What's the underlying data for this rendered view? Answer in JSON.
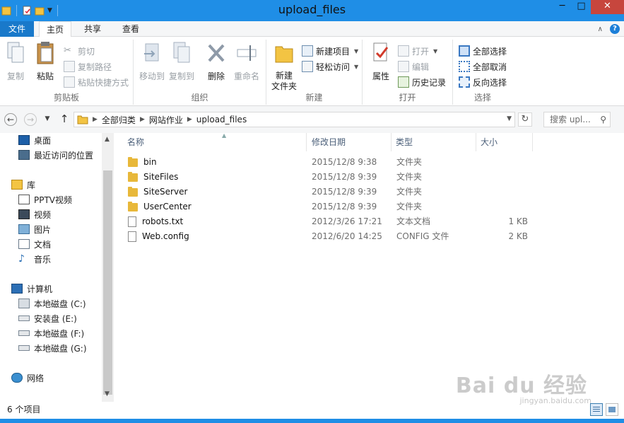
{
  "window": {
    "title": "upload_files",
    "buttons": {
      "minimize": "─",
      "maximize": "□",
      "close": "✕"
    }
  },
  "ribbon_tabs": [
    "文件",
    "主页",
    "共享",
    "查看"
  ],
  "ribbon": {
    "clipboard": {
      "label": "剪贴板",
      "copy": "复制",
      "paste": "粘贴",
      "cut": "剪切",
      "copy_path": "复制路径",
      "paste_shortcut": "粘贴快捷方式"
    },
    "organize": {
      "label": "组织",
      "move_to": "移动到",
      "copy_to": "复制到",
      "delete": "删除",
      "rename": "重命名"
    },
    "new": {
      "label": "新建",
      "new_folder_line1": "新建",
      "new_folder_line2": "文件夹",
      "new_item": "新建项目",
      "easy_access": "轻松访问"
    },
    "open": {
      "label": "打开",
      "properties": "属性",
      "open": "打开",
      "edit": "编辑",
      "history": "历史记录"
    },
    "select": {
      "label": "选择",
      "select_all": "全部选择",
      "select_none": "全部取消",
      "invert": "反向选择"
    }
  },
  "address": {
    "breadcrumbs": [
      "全部归类",
      "网站作业",
      "upload_files"
    ],
    "search_placeholder": "搜索 upl..."
  },
  "nav_pane": {
    "favorites": [
      "桌面",
      "最近访问的位置"
    ],
    "library_label": "库",
    "libraries": [
      "PPTV视频",
      "视频",
      "图片",
      "文档",
      "音乐"
    ],
    "computer_label": "计算机",
    "drives": [
      "本地磁盘 (C:)",
      "安装盘 (E:)",
      "本地磁盘 (F:)",
      "本地磁盘 (G:)"
    ],
    "network_label": "网络"
  },
  "columns": {
    "name": "名称",
    "date": "修改日期",
    "type": "类型",
    "size": "大小"
  },
  "files": [
    {
      "name": "bin",
      "date": "2015/12/8 9:38",
      "type": "文件夹",
      "size": "",
      "icon": "folder-icon"
    },
    {
      "name": "SiteFiles",
      "date": "2015/12/8 9:39",
      "type": "文件夹",
      "size": "",
      "icon": "folder-icon"
    },
    {
      "name": "SiteServer",
      "date": "2015/12/8 9:39",
      "type": "文件夹",
      "size": "",
      "icon": "folder-icon"
    },
    {
      "name": "UserCenter",
      "date": "2015/12/8 9:39",
      "type": "文件夹",
      "size": "",
      "icon": "folder-icon"
    },
    {
      "name": "robots.txt",
      "date": "2012/3/26 17:21",
      "type": "文本文档",
      "size": "1 KB",
      "icon": "text-file-icon"
    },
    {
      "name": "Web.config",
      "date": "2012/6/20 14:25",
      "type": "CONFIG 文件",
      "size": "2 KB",
      "icon": "config-file-icon"
    }
  ],
  "status": {
    "item_count": "6 个项目"
  },
  "watermark": {
    "brand": "Bai du 经验",
    "url": "jingyan.baidu.com"
  },
  "colors": {
    "titlebar": "#1f8ee6",
    "file_tab": "#1979ca",
    "close": "#c7463d",
    "folder": "#e8b83a"
  }
}
